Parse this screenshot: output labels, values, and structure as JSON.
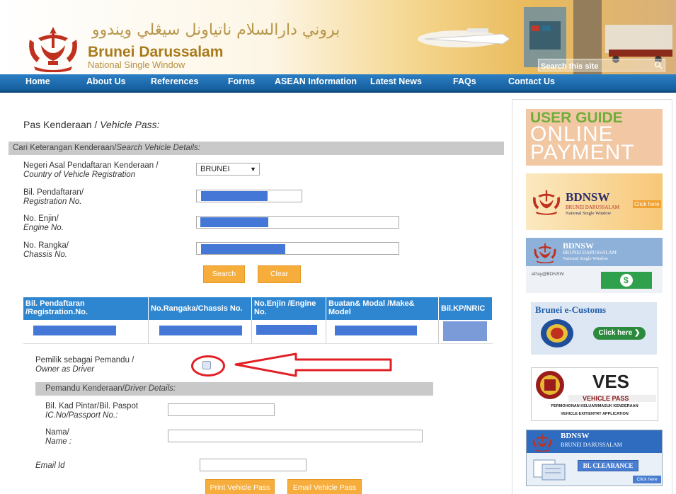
{
  "header": {
    "arabic_title": "بروني دارالسلام ناتياونل سيڠلي ويندوو",
    "brand": "Brunei Darussalam",
    "tagline": "National Single Window",
    "search_placeholder": "Search this site"
  },
  "nav": [
    "Home",
    "About Us",
    "References",
    "Forms",
    "ASEAN Information",
    "Latest News",
    "FAQs",
    "Contact Us"
  ],
  "page": {
    "title": "Pas Kenderaan / ",
    "title_en": "Vehicle Pass:"
  },
  "search_section": {
    "heading": "Cari Keterangan Kenderaan/",
    "heading_en": "Search Vehicle Details:",
    "country_label": "Negeri Asal Pendaftaran Kenderaan /",
    "country_label_en": "Country of Vehicle Registration",
    "country_value": "BRUNEI",
    "reg_label": "Bil. Pendaftaran/",
    "reg_label_en": "Registration No.",
    "engine_label": "No. Enjin/",
    "engine_label_en": "Engine No.",
    "chassis_label": "No. Rangka/",
    "chassis_label_en": "Chassis No.",
    "search_btn": "Search",
    "clear_btn": "Clear"
  },
  "results": {
    "headers": [
      "Bil. Pendaftaran /Registration.No.",
      "No.Rangaka/Chassis No.",
      "No.Enjin /Engine No.",
      "Buatan& Modal /Make& Model",
      "Bil.KP/NRIC"
    ]
  },
  "owner": {
    "label": "Pemilik sebagai Pemandu /",
    "label_en": "Owner as Driver"
  },
  "driver_section": {
    "heading": "Pemandu Kenderaan/",
    "heading_en": "Driver Details:",
    "ic_label": "Bil. Kad Pintar/Bil. Paspot",
    "ic_label_en": "IC.No/Passport No.:",
    "name_label": "Nama/",
    "name_label_en": "Name :",
    "email_label": "Email Id",
    "print_btn": "Print Vehicle Pass",
    "email_btn": "Email Vehicle Pass"
  },
  "sidebar": {
    "userguide_line1": "USER GUIDE",
    "userguide_line2": "ONLINE",
    "userguide_line3": "PAYMENT",
    "bdnsw": "BDNSW",
    "bdnsw_sub1": "BRUNEI DARUSSALAM",
    "bdnsw_sub2": "National Single Window",
    "click_here": "Click here",
    "epay": "ePay@BDNSW",
    "ecustoms": "Brunei e-Customs",
    "click_here_arrow": "Click here",
    "ves": "VES",
    "ves_sub": "VEHICLE PASS",
    "ves_desc1": "PERMOHONAN KELUAR/MASUK KENDERAAN",
    "ves_desc2": "VEHICLE EXIT/ENTRY APPLICATION",
    "clearance_title": "BDNSW",
    "clearance_sub": "BRUNEI DARUSSALAM",
    "clearance": "BL CLEARANCE",
    "clearance_click": "Click here"
  },
  "colors": {
    "nav_blue": "#1f6fb4",
    "button_orange": "#f6ad3b",
    "table_header": "#2f86d0",
    "redaction": "#4577d6",
    "annotation_red": "#e31f26"
  }
}
